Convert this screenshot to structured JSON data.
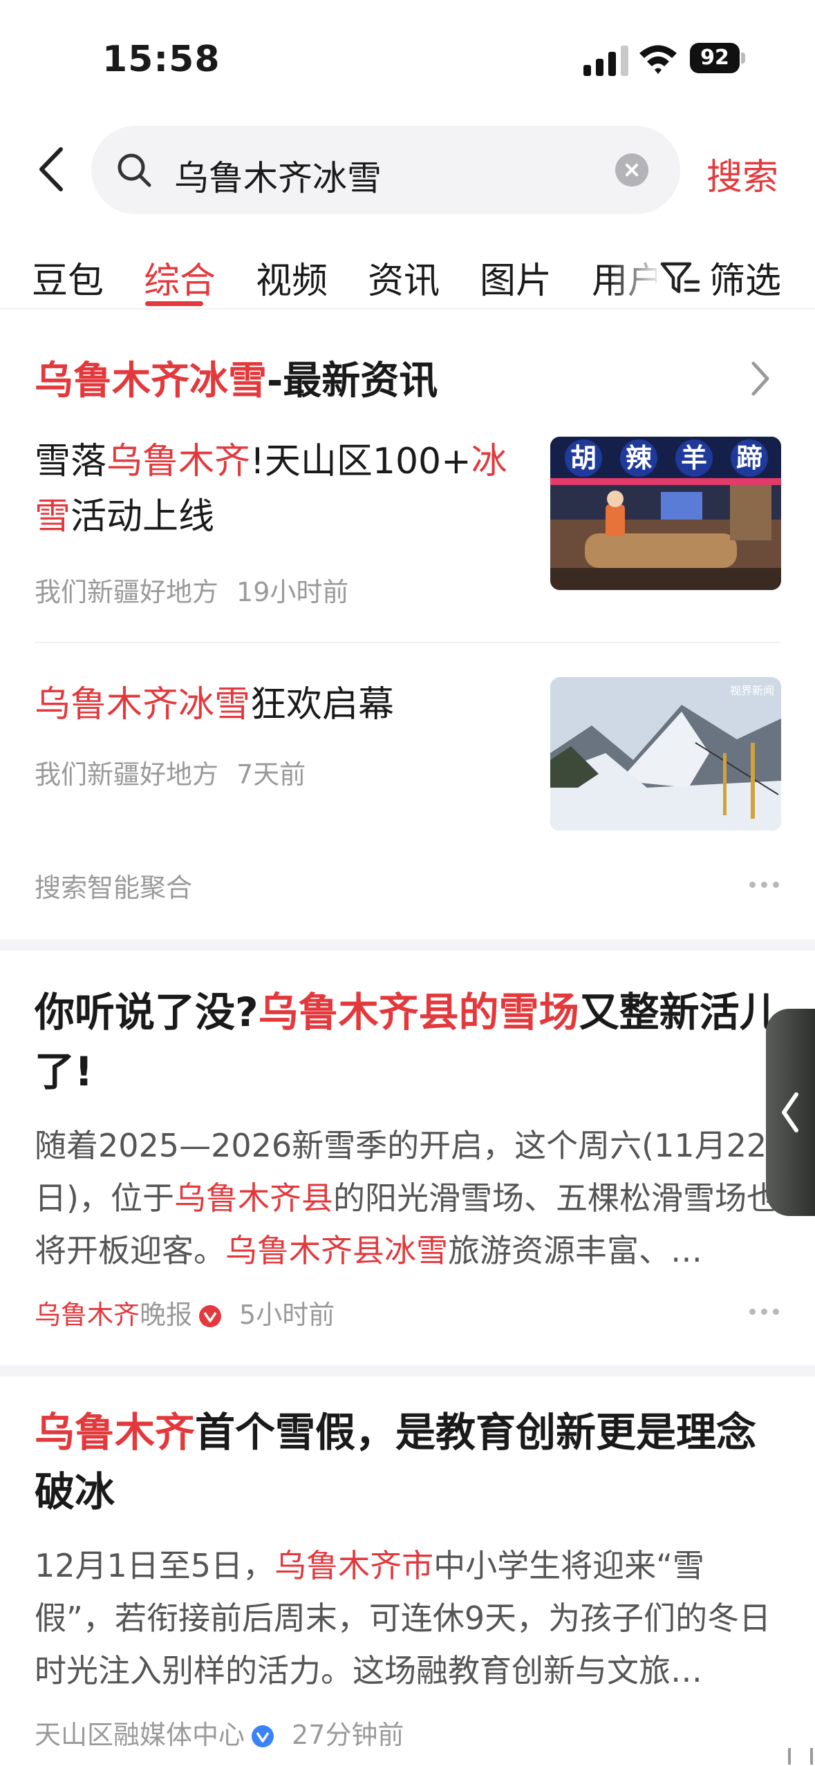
{
  "status_bar": {
    "time": "15:58",
    "battery": "92"
  },
  "search": {
    "query": "乌鲁木齐冰雪",
    "button_label": "搜索"
  },
  "tabs": [
    {
      "label": "豆包"
    },
    {
      "label": "综合",
      "active": true
    },
    {
      "label": "视频"
    },
    {
      "label": "资讯"
    },
    {
      "label": "图片"
    },
    {
      "label": "用户"
    }
  ],
  "filter_label": "筛选",
  "news_section": {
    "title_highlight": "乌鲁木齐冰雪",
    "title_rest": "-最新资讯",
    "items": [
      {
        "title_parts": [
          "雪落",
          "乌鲁木齐",
          "!天山区100+",
          "冰雪",
          "活动上线"
        ],
        "source": "我们新疆好地方",
        "time": "19小时前",
        "thumb_text": [
          "胡",
          "辣",
          "羊",
          "蹄"
        ]
      },
      {
        "title_parts": [
          "乌鲁木齐冰雪",
          "狂欢启幕"
        ],
        "source": "我们新疆好地方",
        "time": "7天前",
        "thumb_watermark": "视界新闻"
      }
    ],
    "aggregation_label": "搜索智能聚合"
  },
  "articles": [
    {
      "title_parts": [
        "你听说了没?",
        "乌鲁木齐县的雪场",
        "又整新活儿了!"
      ],
      "body_parts": [
        "随着2025—2026新雪季的开启，这个周六(11月22日)，位于",
        "乌鲁木齐县",
        "的阳光滑雪场、五棵松滑雪场也将开板迎客。",
        "乌鲁木齐县冰雪",
        "旅游资源丰富、…"
      ],
      "source_highlight": "乌鲁木齐",
      "source_rest": "晚报",
      "time": "5小时前",
      "badge_color": "#e3393c"
    },
    {
      "title_parts": [
        "乌鲁木齐",
        "首个雪假，是教育创新更是理念破冰"
      ],
      "body_parts": [
        "12月1日至5日，",
        "乌鲁木齐市",
        "中小学生将迎来“雪假”，若衔接前后周末，可连休9天，为孩子们的冬日时光注入别样的活力。这场融教育创新与文旅…"
      ],
      "source": "天山区融媒体中心",
      "time": "27分钟前",
      "badge_color": "#3b82f6"
    }
  ],
  "colors": {
    "accent": "#e3393c",
    "text": "#1a1a1a",
    "muted": "#9a9a9a"
  }
}
